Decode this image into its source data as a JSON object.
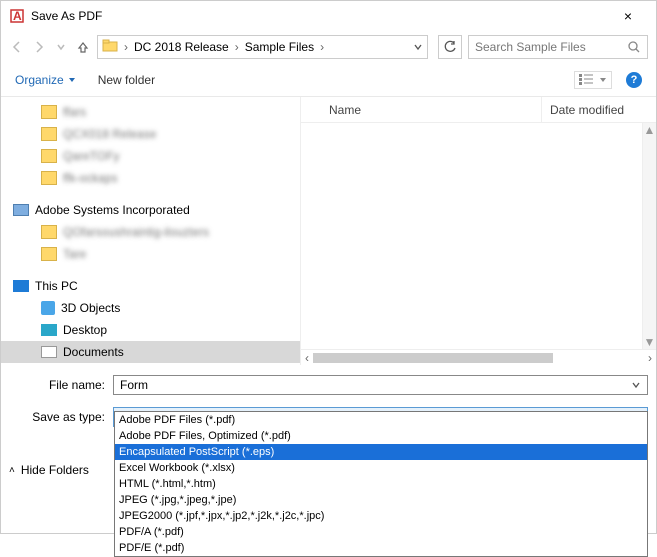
{
  "window": {
    "title": "Save As PDF"
  },
  "nav": {
    "crumb1": "DC 2018 Release",
    "crumb2": "Sample Files",
    "refresh": "↻"
  },
  "search": {
    "placeholder": "Search Sample Files"
  },
  "toolbar": {
    "organize": "Organize",
    "newfolder": "New folder"
  },
  "columns": {
    "name": "Name",
    "date": "Date modified"
  },
  "tree": {
    "blur1": "ffars",
    "blur2": "QCX018 Release",
    "blur3": "QareTOFy",
    "blur4": "ffk-ockaps",
    "group1": "Adobe Systems Incorporated",
    "blur5": "QOfarsoushraintig-ilouzters",
    "blur6": "Tare",
    "thispc": "This PC",
    "obj3d": "3D Objects",
    "desktop": "Desktop",
    "documents": "Documents"
  },
  "form": {
    "filename_label": "File name:",
    "filename_value": "Form",
    "savetype_label": "Save as type:",
    "savetype_value": "Adobe PDF Files (*.pdf)"
  },
  "typelist": {
    "opt0": "Adobe PDF Files (*.pdf)",
    "opt1": "Adobe PDF Files, Optimized (*.pdf)",
    "opt2": "Encapsulated PostScript (*.eps)",
    "opt3": "Excel Workbook (*.xlsx)",
    "opt4": "HTML (*.html,*.htm)",
    "opt5": "JPEG (*.jpg,*.jpeg,*.jpe)",
    "opt6": "JPEG2000 (*.jpf,*.jpx,*.jp2,*.j2k,*.j2c,*.jpc)",
    "opt7": "PDF/A (*.pdf)",
    "opt8": "PDF/E (*.pdf)"
  },
  "footer": {
    "hide": "Hide Folders"
  }
}
